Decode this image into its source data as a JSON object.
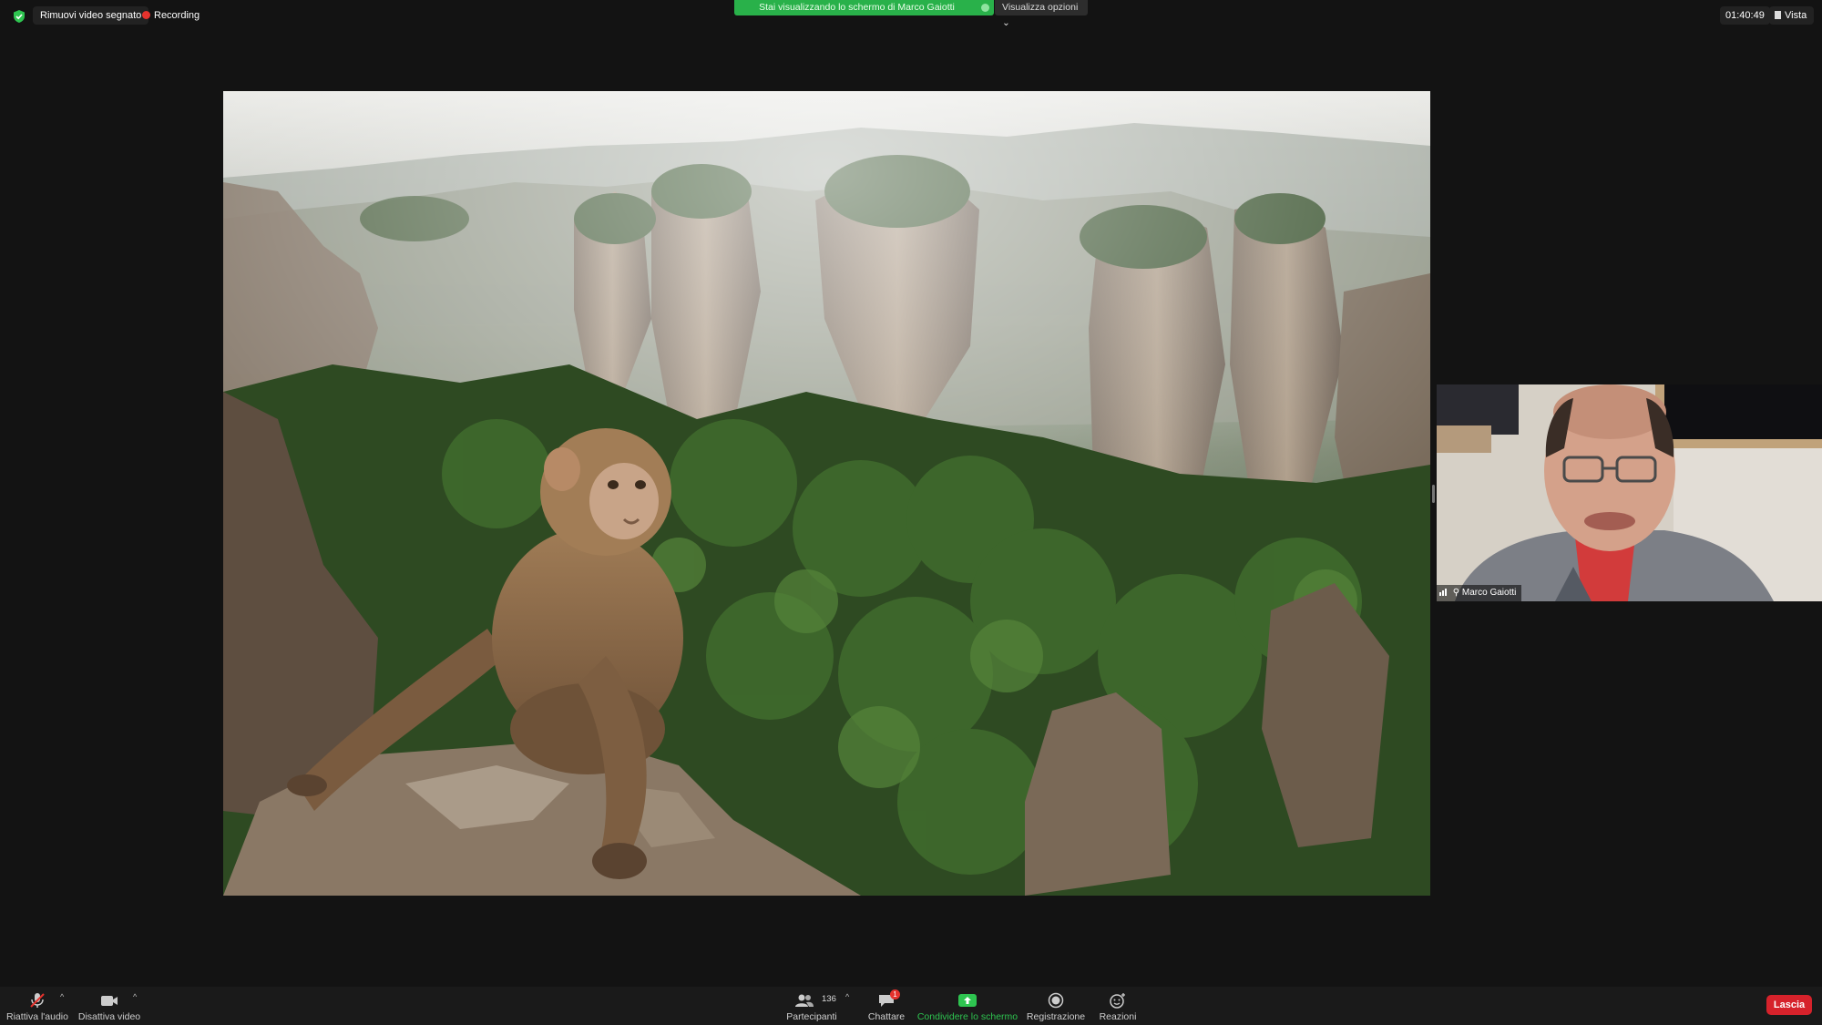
{
  "top_bar": {
    "remove_video_label": "Rimuovi video segnato",
    "recording_label": "Recording",
    "share_banner_text": "Stai visualizzando lo schermo di Marco Gaiotti",
    "view_options_label": "Visualizza opzioni",
    "meeting_time": "01:40:49",
    "view_label": "Vista"
  },
  "participant_tile": {
    "name": "Marco Gaiotti"
  },
  "toolbar": {
    "unmute_label": "Riattiva l'audio",
    "stop_video_label": "Disattiva video",
    "participants_label": "Partecipanti",
    "participants_count": "136",
    "chat_label": "Chattare",
    "chat_badge": "1",
    "share_screen_label": "Condividere lo schermo",
    "record_label": "Registrazione",
    "reactions_label": "Reazioni",
    "leave_label": "Lascia"
  },
  "colors": {
    "accent_green": "#29b14a",
    "leave_red": "#d6222b",
    "recording_red": "#e5322d"
  },
  "icons": [
    "shield-icon",
    "microphone-muted-icon",
    "video-camera-icon",
    "participants-icon",
    "chat-icon",
    "share-screen-icon",
    "record-icon",
    "reactions-icon"
  ]
}
